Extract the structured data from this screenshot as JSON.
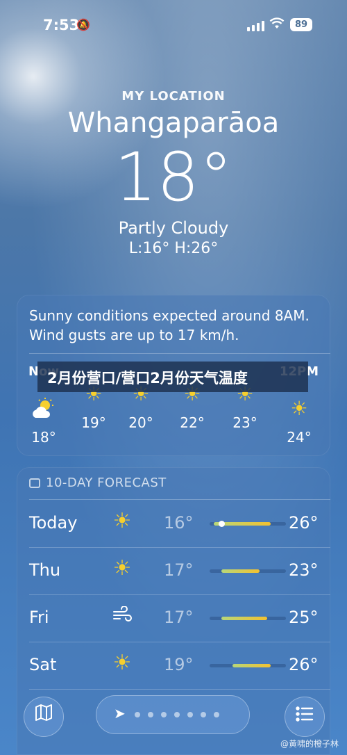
{
  "status_bar": {
    "time": "7:53",
    "battery": "89"
  },
  "location": {
    "label": "MY LOCATION",
    "city": "Whangaparāoa",
    "temperature": "18°",
    "condition": "Partly Cloudy",
    "low_high": "L:16° H:26°"
  },
  "hourly": {
    "summary": "Sunny conditions expected around 8AM. Wind gusts are up to 17 km/h.",
    "items": [
      {
        "time": "Now",
        "icon": "partly-cloudy-icon",
        "temp": "18°"
      },
      {
        "time": "",
        "icon": "sun-icon",
        "temp": "19°"
      },
      {
        "time": "",
        "icon": "sun-icon",
        "temp": "20°"
      },
      {
        "time": "",
        "icon": "sun-icon",
        "temp": "22°"
      },
      {
        "time": "",
        "icon": "sun-icon",
        "temp": "23°"
      },
      {
        "time": "12PM",
        "icon": "sun-icon",
        "temp": "24°"
      }
    ]
  },
  "overlay_banner": "2月份营口/营口2月份天气温度",
  "forecast": {
    "title": "10-DAY FORECAST",
    "days": [
      {
        "day": "Today",
        "icon": "sun-icon",
        "low": "16°",
        "high": "26°",
        "bar_start": 0.05,
        "bar_end": 0.8,
        "current": 0.15
      },
      {
        "day": "Thu",
        "icon": "sun-icon",
        "low": "17°",
        "high": "23°",
        "bar_start": 0.15,
        "bar_end": 0.65
      },
      {
        "day": "Fri",
        "icon": "wind-icon",
        "low": "17°",
        "high": "25°",
        "bar_start": 0.15,
        "bar_end": 0.75
      },
      {
        "day": "Sat",
        "icon": "sun-icon",
        "low": "19°",
        "high": "26°",
        "bar_start": 0.3,
        "bar_end": 0.8
      }
    ]
  },
  "toolbar": {
    "map_label": "map",
    "list_label": "list"
  },
  "watermark": "@黄啸的橙子林"
}
